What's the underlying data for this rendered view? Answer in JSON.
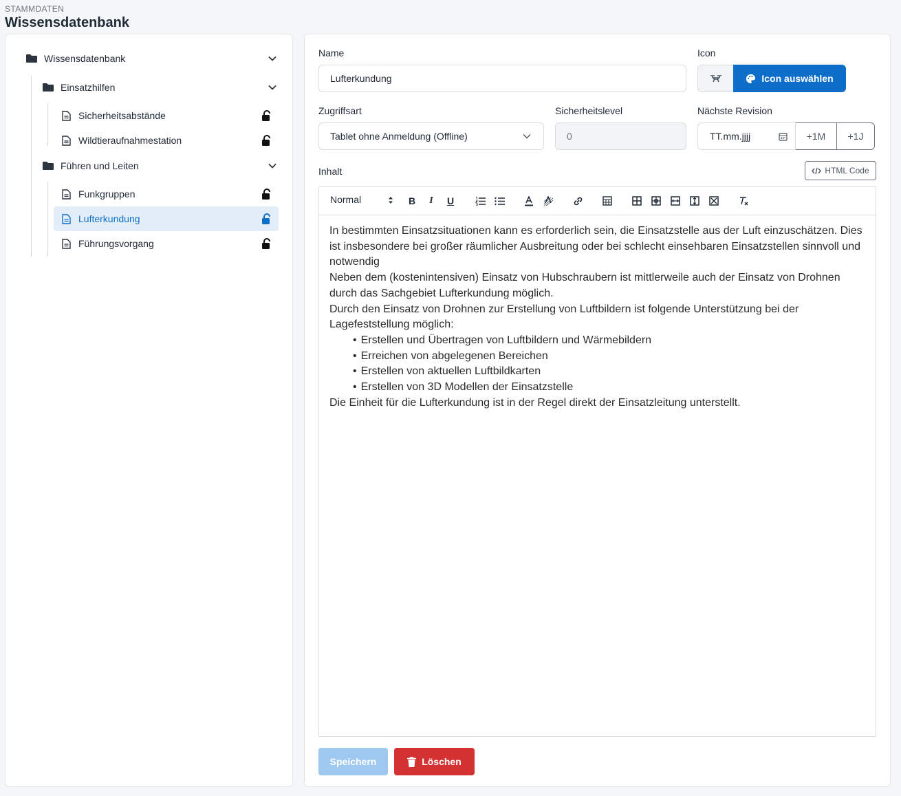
{
  "header": {
    "section": "STAMMDATEN",
    "title": "Wissensdatenbank"
  },
  "tree": {
    "root": {
      "label": "Wissensdatenbank"
    },
    "groups": [
      {
        "label": "Einsatzhilfen",
        "items": [
          {
            "label": "Sicherheitsabstände"
          },
          {
            "label": "Wildtieraufnahmestation"
          }
        ]
      },
      {
        "label": "Führen und Leiten",
        "items": [
          {
            "label": "Funkgruppen"
          },
          {
            "label": "Lufterkundung"
          },
          {
            "label": "Führungsvorgang"
          }
        ]
      }
    ]
  },
  "form": {
    "name_label": "Name",
    "name_value": "Lufterkundung",
    "icon_label": "Icon",
    "icon_preview": "drone-icon",
    "icon_button": "Icon auswählen",
    "access_label": "Zugriffsart",
    "access_value": "Tablet ohne Anmeldung (Offline)",
    "security_label": "Sicherheitslevel",
    "security_value": "0",
    "revision_label": "Nächste Revision",
    "revision_placeholder": "TT.mm.jjjj",
    "revision_plus_month": "+1M",
    "revision_plus_year": "+1J",
    "content_label": "Inhalt",
    "html_button": "HTML Code"
  },
  "editor": {
    "format_select": "Normal",
    "paragraphs": [
      "In bestimmten Einsatzsituationen kann es erforderlich sein, die Einsatzstelle aus der Luft einzuschätzen. Dies ist insbesondere bei großer räumlicher Ausbreitung oder bei schlecht einsehbaren Einsatzstellen sinnvoll und notwendig",
      "Neben dem (kostenintensiven) Einsatz von Hubschraubern ist mittlerweile auch der Einsatz von Drohnen durch das Sachgebiet Lufterkundung möglich.",
      "Durch den Einsatz von Drohnen zur Erstellung von Luftbildern ist folgende Unterstützung bei der Lagefeststellung möglich:"
    ],
    "bullets": [
      "Erstellen und Übertragen von Luftbildern und Wärmebildern",
      "Erreichen von abgelegenen Bereichen",
      "Erstellen von aktuellen Luftbildkarten",
      "Erstellen von 3D Modellen der Einsatzstelle"
    ],
    "closing": "Die Einheit für die Lufterkundung ist in der Regel direkt der Einsatzleitung unterstellt."
  },
  "actions": {
    "save": "Speichern",
    "delete": "Löschen"
  },
  "colors": {
    "primary": "#0d6ec9",
    "danger": "#d43232",
    "save_disabled": "#9ec8ef",
    "active_row": "#e4eef9"
  }
}
